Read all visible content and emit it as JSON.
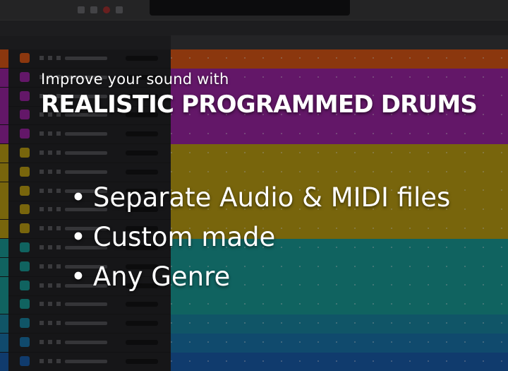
{
  "overlay": {
    "headline": "Improve your sound with",
    "title": "REALISTIC PROGRAMMED DRUMS",
    "bullets": [
      "Separate Audio & MIDI files",
      "Custom made",
      "Any Genre"
    ],
    "bullet_glyph": "•"
  },
  "daw": {
    "track_colors": [
      "#e05a17",
      "#a026a8",
      "#a026a8",
      "#a026a8",
      "#a026a8",
      "#c2a414",
      "#c2a414",
      "#c2a414",
      "#c2a414",
      "#c2a414",
      "#1aa09c",
      "#1aa09c",
      "#1aa09c",
      "#1aa09c",
      "#1a8aa6",
      "#1a78b0",
      "#1a5fb0"
    ]
  },
  "colors": {
    "text": "#ffffff",
    "orange": "#e05a17",
    "purple": "#a026a8",
    "yellow": "#c2a414",
    "teal": "#1aa09c",
    "blue": "#1a78b0"
  }
}
